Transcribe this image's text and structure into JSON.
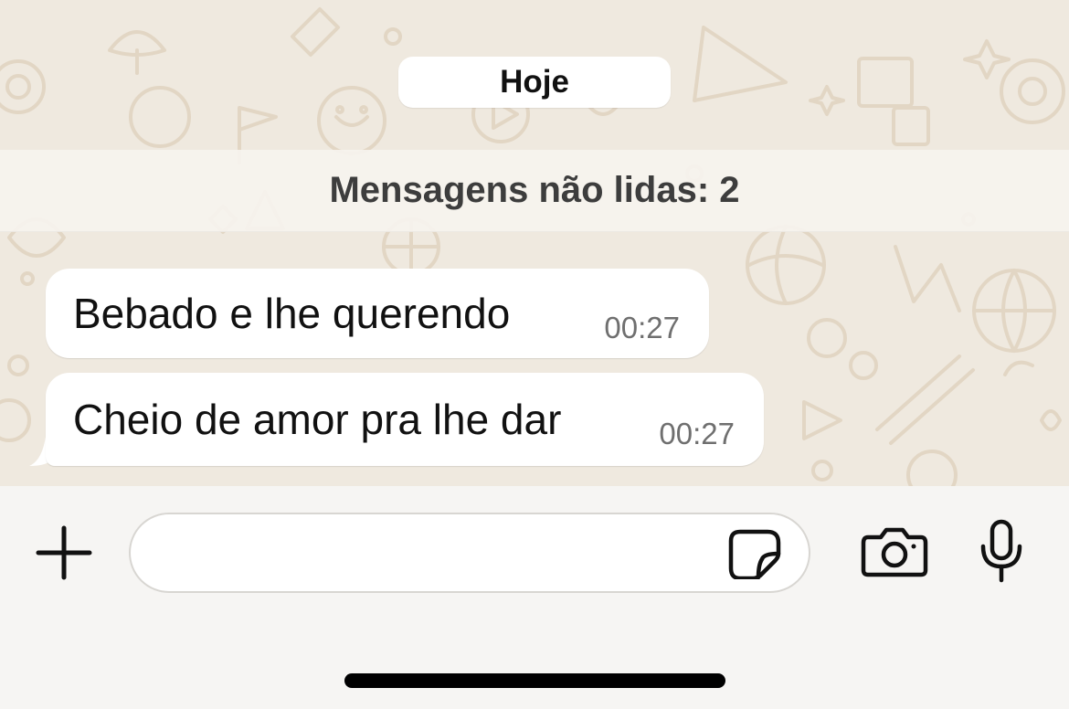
{
  "chat": {
    "date_chip": "Hoje",
    "unread_banner": "Mensagens não lidas: 2",
    "messages": [
      {
        "text": "Bebado e lhe querendo",
        "time": "00:27"
      },
      {
        "text": "Cheio de amor pra lhe dar",
        "time": "00:27"
      }
    ]
  },
  "composer": {
    "placeholder": "",
    "value": ""
  },
  "icons": {
    "attach": "plus-icon",
    "sticker": "sticker-icon",
    "camera": "camera-icon",
    "microphone": "microphone-icon"
  },
  "colors": {
    "wallpaper": "#efe9df",
    "bubble": "#ffffff",
    "input_bar": "#f6f5f3",
    "timestamp": "#6f6f6f"
  }
}
